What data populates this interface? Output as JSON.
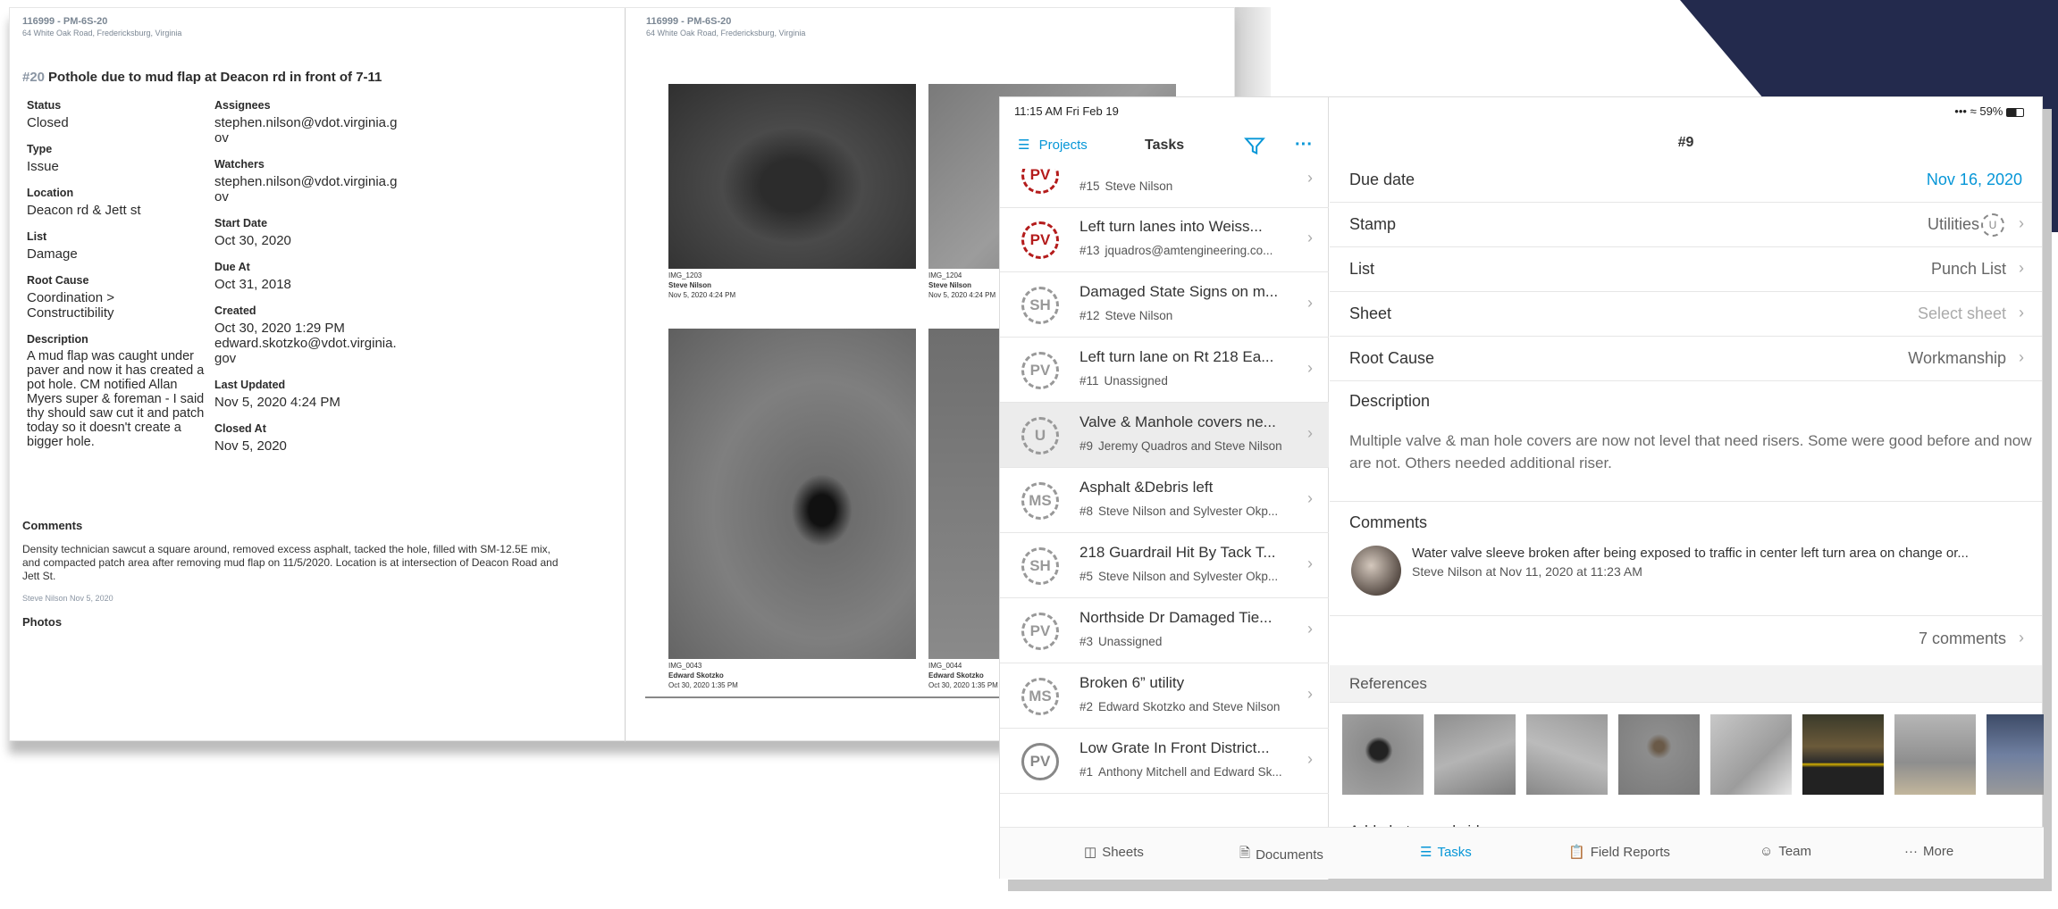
{
  "doc": {
    "left": {
      "project_id": "116999 - PM-6S-20",
      "address": "64 White Oak Road, Fredericksburg, Virginia",
      "issue_number": "#20",
      "issue_title": "Pothole due to mud flap at Deacon rd in front of 7-11",
      "status_label": "Status",
      "status_value": "Closed",
      "type_label": "Type",
      "type_value": "Issue",
      "location_label": "Location",
      "location_value": "Deacon rd & Jett st",
      "list_label": "List",
      "list_value": "Damage",
      "root_cause_label": "Root Cause",
      "root_cause_value": "Coordination > Constructibility",
      "description_label": "Description",
      "description_value": "A mud flap was caught under paver and now it has created a pot hole. CM notified Allan Myers super & foreman - I said thy should saw cut it and patch today so it doesn't create a bigger hole.",
      "assignees_label": "Assignees",
      "assignees_value": "stephen.nilson@vdot.virginia.gov",
      "watchers_label": "Watchers",
      "watchers_value": "stephen.nilson@vdot.virginia.gov",
      "start_date_label": "Start Date",
      "start_date_value": "Oct 30, 2020",
      "due_at_label": "Due At",
      "due_at_value": "Oct 31, 2018",
      "created_label": "Created",
      "created_value": "Oct 30, 2020 1:29 PM",
      "created_by": "edward.skotzko@vdot.virginia.gov",
      "last_updated_label": "Last Updated",
      "last_updated_value": "Nov 5, 2020 4:24 PM",
      "closed_at_label": "Closed At",
      "closed_at_value": "Nov 5, 2020",
      "comments_label": "Comments",
      "comment_text": "Density technician sawcut a square around, removed excess asphalt, tacked the hole, filled with SM-12.5E mix, and compacted patch area after removing mud flap on 11/5/2020. Location is at intersection of Deacon Road and Jett St.",
      "comment_author": "Steve Nilson",
      "comment_date": "Nov 5, 2020",
      "photos_label": "Photos"
    },
    "right": {
      "project_id": "116999 - PM-6S-20",
      "address": "64 White Oak Road, Fredericksburg, Virginia",
      "photos": [
        {
          "name": "IMG_1203",
          "author": "Steve Nilson",
          "date": "Nov 5, 2020 4:24 PM"
        },
        {
          "name": "IMG_1204",
          "author": "Steve Nilson",
          "date": "Nov 5, 2020 4:24 PM"
        },
        {
          "name": "IMG_0043",
          "author": "Edward Skotzko",
          "date": "Oct 30, 2020 1:35 PM"
        },
        {
          "name": "IMG_0044",
          "author": "Edward Skotzko",
          "date": "Oct 30, 2020 1:35 PM"
        }
      ]
    }
  },
  "status_bar": {
    "time": "11:15 AM   Fri Feb 19",
    "battery": "59%"
  },
  "nav": {
    "projects": "Projects",
    "title": "Tasks"
  },
  "tasks": [
    {
      "stamp": "PV",
      "color": "#b41c1c",
      "title": "",
      "number": "#15",
      "assignee": "Steve Nilson"
    },
    {
      "stamp": "PV",
      "color": "#b41c1c",
      "title": "Left turn lanes into Weiss...",
      "number": "#13",
      "assignee": "jquadros@amtengineering.co..."
    },
    {
      "stamp": "SH",
      "color": "#999999",
      "title": "Damaged State Signs on m...",
      "number": "#12",
      "assignee": "Steve Nilson"
    },
    {
      "stamp": "PV",
      "color": "#999999",
      "title": "Left turn lane on Rt 218 Ea...",
      "number": "#11",
      "assignee": "Unassigned"
    },
    {
      "stamp": "U",
      "color": "#999999",
      "title": "Valve & Manhole covers ne...",
      "number": "#9",
      "assignee": "Jeremy Quadros and Steve Nilson"
    },
    {
      "stamp": "MS",
      "color": "#999999",
      "title": "Asphalt &Debris left",
      "number": "#8",
      "assignee": "Steve Nilson  and Sylvester Okp..."
    },
    {
      "stamp": "SH",
      "color": "#999999",
      "title": "218 Guardrail Hit By Tack T...",
      "number": "#5",
      "assignee": "Steve Nilson  and Sylvester Okp..."
    },
    {
      "stamp": "PV",
      "color": "#999999",
      "title": "Northside Dr Damaged Tie...",
      "number": "#3",
      "assignee": "Unassigned"
    },
    {
      "stamp": "MS",
      "color": "#999999",
      "title": "Broken 6” utility",
      "number": "#2",
      "assignee": "Edward Skotzko and Steve Nilson"
    },
    {
      "stamp": "PV",
      "color": "#888888",
      "title": "Low Grate In Front District...",
      "number": "#1",
      "assignee": "Anthony Mitchell and Edward Sk..."
    }
  ],
  "detail": {
    "title": "#9",
    "due_date_label": "Due date",
    "due_date_value": "Nov 16, 2020",
    "stamp_label": "Stamp",
    "stamp_value": "Utilities",
    "list_label": "List",
    "list_value": "Punch List",
    "sheet_label": "Sheet",
    "sheet_value": "Select sheet",
    "root_cause_label": "Root Cause",
    "root_cause_value": "Workmanship",
    "description_label": "Description",
    "description_value": "Multiple valve & man hole covers are now not level that need risers. Some were good before and now are not. Others needed additional riser.",
    "comments_label": "Comments",
    "comment_text": "Water valve sleeve broken after being exposed to traffic in center left turn area on change or...",
    "comment_meta": "Steve Nilson  at Nov 11, 2020 at 11:23 AM",
    "comments_count": "7 comments",
    "references_label": "References",
    "add_photos": "Add photos and videos"
  },
  "tabbar": [
    "Sheets",
    "Documents",
    "Tasks",
    "Field Reports",
    "Team",
    "More"
  ],
  "colors": {
    "accent": "#0696d7",
    "stamp_red": "#b41c1c",
    "background_navy": "#232a4d"
  }
}
